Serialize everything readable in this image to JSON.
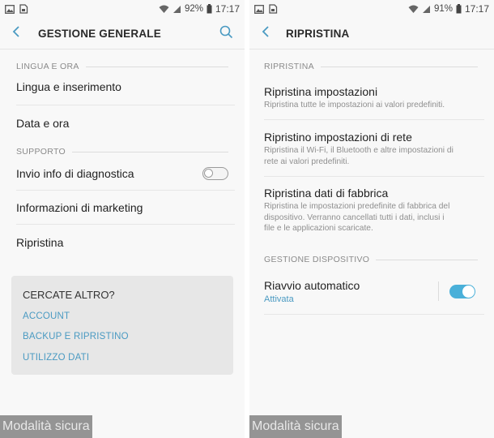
{
  "left": {
    "status": {
      "battery": "92%",
      "time": "17:17"
    },
    "appbar": {
      "title": "GESTIONE GENERALE"
    },
    "sections": {
      "lingua": "LINGUA E ORA",
      "supporto": "SUPPORTO"
    },
    "items": {
      "lingua_inserimento": "Lingua e inserimento",
      "data_ora": "Data e ora",
      "invio_diagnostica": "Invio info di diagnostica",
      "info_marketing": "Informazioni di marketing",
      "ripristina": "Ripristina"
    },
    "diagnostica_toggle": "off",
    "card": {
      "title": "CERCATE ALTRO?",
      "links": [
        "ACCOUNT",
        "BACKUP E RIPRISTINO",
        "UTILIZZO DATI"
      ]
    },
    "safe_mode": "Modalità sicura"
  },
  "right": {
    "status": {
      "battery": "91%",
      "time": "17:17"
    },
    "appbar": {
      "title": "RIPRISTINA"
    },
    "sections": {
      "ripristina": "RIPRISTINA",
      "gestione": "GESTIONE DISPOSITIVO"
    },
    "items": [
      {
        "title": "Ripristina impostazioni",
        "sub": "Ripristina tutte le impostazioni ai valori predefiniti."
      },
      {
        "title": "Ripristino impostazioni di rete",
        "sub1": "Ripristina il Wi-Fi, il Bluetooth e altre impostazioni di",
        "sub2": "rete ai valori predefiniti."
      },
      {
        "title": "Ripristina dati di fabbrica",
        "sub1": "Ripristina le impostazioni predefinite di fabbrica del",
        "sub2": "dispositivo. Verranno cancellati tutti i dati, inclusi i",
        "sub3": "file e le applicazioni scaricate."
      }
    ],
    "riavvio": {
      "title": "Riavvio automatico",
      "status": "Attivata",
      "toggle": "on"
    },
    "safe_mode": "Modalità sicura"
  },
  "colors": {
    "accent": "#4ab0d9",
    "link": "#4a9ac2"
  },
  "icons": [
    "image-icon",
    "sim-icon",
    "wifi-icon",
    "signal-icon",
    "battery-icon",
    "back-arrow-icon",
    "search-icon"
  ]
}
